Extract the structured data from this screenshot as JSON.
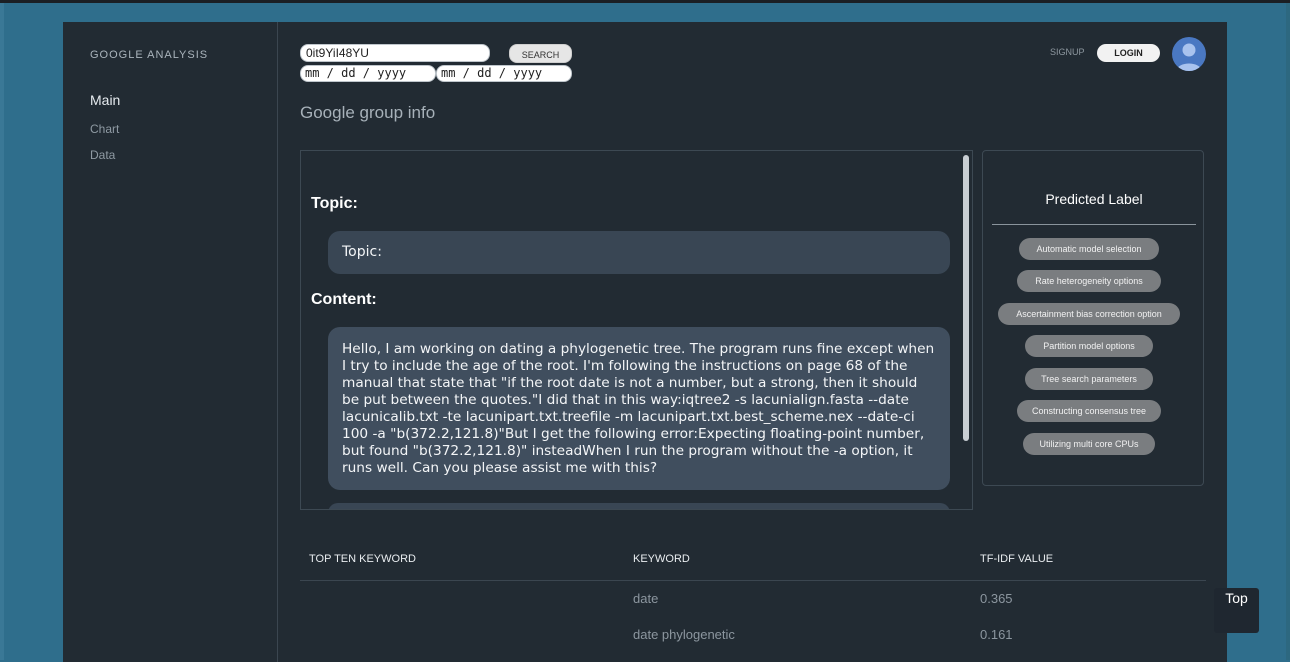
{
  "sidebar": {
    "brand": "GOOGLE ANALYSIS",
    "items": [
      {
        "label": "Main"
      },
      {
        "label": "Chart"
      },
      {
        "label": "Data"
      }
    ]
  },
  "header": {
    "search_value": "0it9YiI48YU",
    "search_button": "SEARCH",
    "date_from_placeholder": "mm / dd / yyyy",
    "date_to_placeholder": "mm / dd / yyyy",
    "signup": "SIGNUP",
    "login": "LOGIN"
  },
  "page": {
    "title": "Google group info"
  },
  "post": {
    "topic_heading": "Topic:",
    "topic_text": "Topic:",
    "content_heading": "Content:",
    "content_text": "Hello, I am working on dating a phylogenetic tree. The program runs fine except when I try to include the age of the root. I'm following the instructions on page 68 of the manual that state that \"if the root date is not a number, but a strong, then it should be put between the quotes.\"I did that in this way:iqtree2 -s lacunialign.fasta --date lacunicalib.txt -te lacunipart.txt.treefile -m lacunipart.txt.best_scheme.nex --date-ci 100 -a \"b(372.2,121.8)\"But I get the following error:Expecting floating-point number, but found \"b(372.2,121.8)\" insteadWhen I run the program without the -a option, it runs well. Can you please assist me with this?"
  },
  "predicted": {
    "title": "Predicted Label",
    "labels": [
      "Automatic model selection",
      "Rate heterogeneity options",
      "Ascertainment bias correction option",
      "Partition model options",
      "Tree search parameters",
      "Constructing consensus tree",
      "Utilizing multi core CPUs"
    ]
  },
  "keywords": {
    "headers": [
      "TOP TEN KEYWORD",
      "KEYWORD",
      "TF-IDF VALUE"
    ],
    "rows": [
      {
        "keyword": "date",
        "value": "0.365"
      },
      {
        "keyword": "date phylogenetic",
        "value": "0.161"
      }
    ]
  },
  "top_button": "Top"
}
